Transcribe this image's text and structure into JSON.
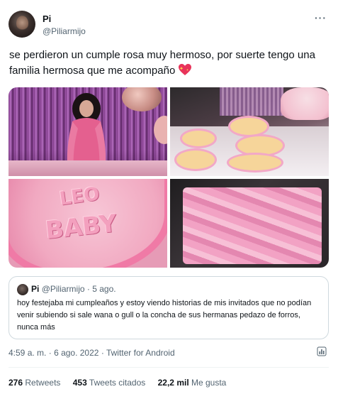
{
  "author": {
    "name": "Pi",
    "handle": "@Piliarmijo"
  },
  "tweet": {
    "text": "se perdieron un cumple rosa muy hermoso, por suerte tengo una familia hermosa que me acompaño",
    "emoji": "heart-with-sparkles-icon"
  },
  "media": {
    "cake_text_line1": "LEO",
    "cake_text_line2": "BABY"
  },
  "quoted_tweet": {
    "name": "Pi",
    "handle": "@Piliarmijo",
    "time": "5 ago.",
    "text": "hoy festejaba mi cumpleaños y estoy viendo historias de mis invitados que no podían venir subiendo si sale wana o gull o la concha de sus hermanas pedazo de forros, nunca más"
  },
  "meta": {
    "time": "4:59 a. m.",
    "date": "6 ago. 2022",
    "source": "Twitter for Android",
    "separator": "·"
  },
  "stats": {
    "retweets_count": "276",
    "retweets_label": "Retweets",
    "quotes_count": "453",
    "quotes_label": "Tweets citados",
    "likes_count": "22,2 mil",
    "likes_label": "Me gusta"
  },
  "colors": {
    "text": "#0f1419",
    "secondary": "#536471",
    "border": "#cfd9de",
    "accent_pink": "#f06292"
  }
}
